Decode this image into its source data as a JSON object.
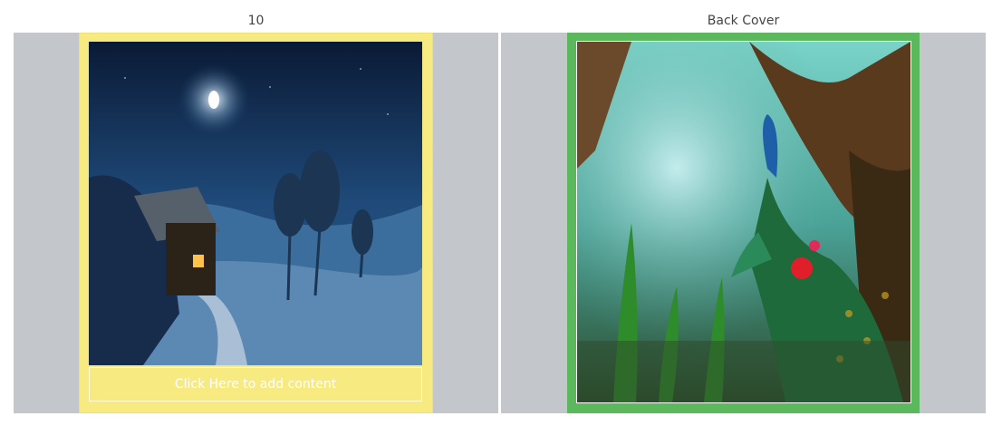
{
  "pages": [
    {
      "label": "10",
      "image_name": "night-cottage-moon-image",
      "add_content_label": "Click Here to add content",
      "frame_color": "#f7ea80"
    },
    {
      "label": "Back Cover",
      "image_name": "peacock-forest-image",
      "frame_color": "#5cb85c"
    }
  ],
  "colors": {
    "spread_background": "#c3c7cb"
  }
}
